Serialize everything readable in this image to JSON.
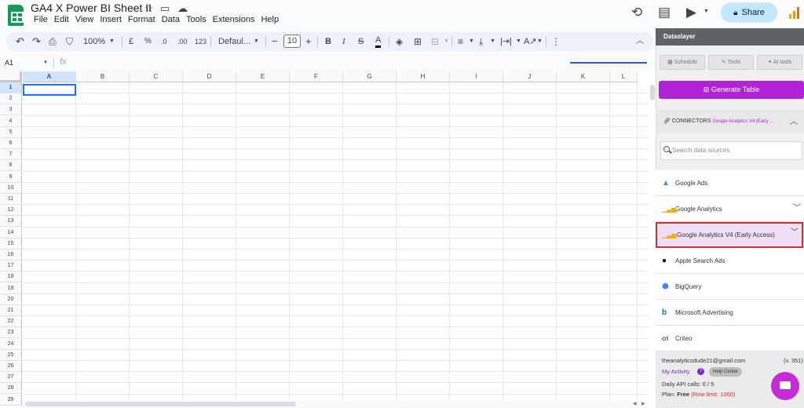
{
  "document": {
    "title": "GA4 X Power BI Sheet II"
  },
  "menu": [
    "File",
    "Edit",
    "View",
    "Insert",
    "Format",
    "Data",
    "Tools",
    "Extensions",
    "Help"
  ],
  "share": {
    "label": "Share"
  },
  "toolbar": {
    "zoom": "100%",
    "currency": "£",
    "percent": "%",
    "dec_decrease": ".0",
    "dec_increase": ".00",
    "number_format": "123",
    "font": "Defaul...",
    "font_size": "10",
    "minus": "−",
    "plus": "+",
    "bold": "B",
    "italic": "I",
    "strike": "S",
    "text_color": "A"
  },
  "formula_bar": {
    "cell_ref": "A1",
    "fx": "fx"
  },
  "grid": {
    "columns": [
      "A",
      "B",
      "C",
      "D",
      "E",
      "F",
      "G",
      "H",
      "I",
      "J",
      "K",
      "L"
    ],
    "rows": [
      "1",
      "2",
      "3",
      "4",
      "5",
      "6",
      "7",
      "8",
      "9",
      "10",
      "11",
      "12",
      "13",
      "14",
      "15",
      "16",
      "17",
      "18",
      "19",
      "20",
      "21",
      "22",
      "23",
      "24",
      "25",
      "26",
      "27",
      "28",
      "29"
    ],
    "selected_cell": "A1"
  },
  "panel": {
    "title": "Dataslayer",
    "tabs": {
      "schedule": "Schedule",
      "tools": "Tools",
      "ai_tools": "AI tools"
    },
    "generate_button": "Generate Table",
    "connectors_label": "CONNECTORS",
    "connectors_current": "Google Analytics V4 (Early ...",
    "search_placeholder": "Search data sources",
    "items": [
      {
        "label": "Google Ads",
        "icon": "google-ads-icon",
        "color": "#4285f4"
      },
      {
        "label": "Google Analytics",
        "icon": "google-analytics-icon",
        "color": "#f9ab00"
      },
      {
        "label": "Google Analytics V4 (Early Access)",
        "icon": "google-analytics-icon",
        "color": "#f9ab00"
      },
      {
        "label": "Apple Search Ads",
        "icon": "apple-icon",
        "color": "#000000"
      },
      {
        "label": "BigQuery",
        "icon": "bigquery-icon",
        "color": "#4285f4"
      },
      {
        "label": "Microsoft Advertising",
        "icon": "microsoft-advertising-icon",
        "color": "#008272"
      },
      {
        "label": "Criteo",
        "icon": "criteo-icon",
        "color": "#000000"
      }
    ],
    "footer": {
      "email": "theanalyticsdude21@gmail.com",
      "version": "(v. 351)",
      "my_activity": "My Activity",
      "help_center": "Help Center",
      "help_q": "?",
      "api_calls": "Daily API calls: 0 / 5",
      "plan_label": "Plan:",
      "plan_value": "Free",
      "row_limit": "(Row limit: 1000)"
    }
  },
  "colors": {
    "accent": "#b023d6",
    "share_bg": "#c2e7ff",
    "sheets_green": "#0f9d58",
    "highlight_border": "#d32f2f"
  }
}
